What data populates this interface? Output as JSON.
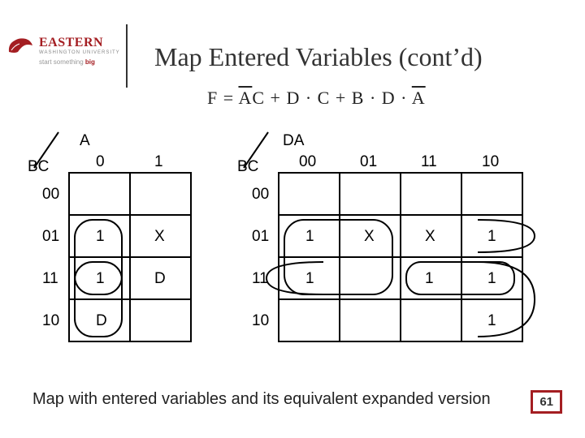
{
  "logo": {
    "name": "EASTERN",
    "sub": "WASHINGTON UNIVERSITY",
    "tag_pre": "start something ",
    "tag_bold": "big"
  },
  "title": "Map Entered Variables (cont’d)",
  "equation": {
    "lhs": "F",
    "eq": "=",
    "t1a": "A",
    "t1b": "C",
    "plus1": "+",
    "t2": "D · C",
    "plus2": "+",
    "t3a": "B · D ·",
    "t3b": "A"
  },
  "kmap1": {
    "col_label": "A",
    "row_label": "BC",
    "cols": [
      "0",
      "1"
    ],
    "rows": [
      "00",
      "01",
      "11",
      "10"
    ],
    "cells": {
      "r1c0": "1",
      "r1c1": "X",
      "r2c0": "1",
      "r2c1": "D",
      "r3c0": "D"
    }
  },
  "kmap2": {
    "col_label": "DA",
    "row_label": "BC",
    "cols": [
      "00",
      "01",
      "11",
      "10"
    ],
    "rows": [
      "00",
      "01",
      "11",
      "10"
    ],
    "cells": {
      "r1c0": "1",
      "r1c1": "X",
      "r1c2": "X",
      "r1c3": "1",
      "r2c0": "1",
      "r2c2": "1",
      "r2c3": "1",
      "r3c3": "1"
    }
  },
  "caption": "Map with entered variables and its equivalent expanded version",
  "page": "61"
}
